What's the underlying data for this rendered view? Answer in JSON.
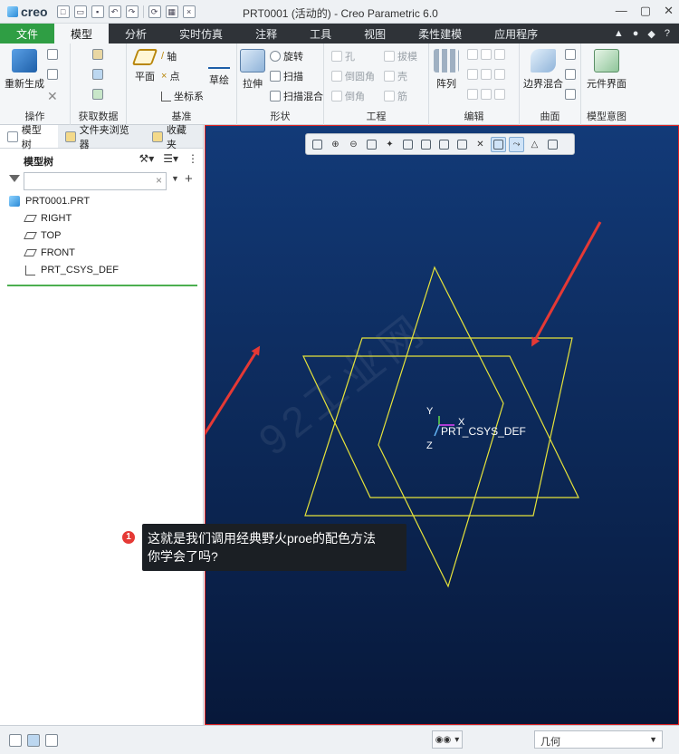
{
  "app": {
    "brand": "creo",
    "window_title": "PRT0001 (活动的) - Creo Parametric 6.0"
  },
  "ribbon_tabs": [
    "文件",
    "模型",
    "分析",
    "实时仿真",
    "注释",
    "工具",
    "视图",
    "柔性建模",
    "应用程序"
  ],
  "ribbon": {
    "operations": {
      "regenerate": "重新生成",
      "label": "操作"
    },
    "get_data": {
      "label": "获取数据"
    },
    "datum": {
      "plane": "平面",
      "axis": "轴",
      "point": "点",
      "csys": "坐标系",
      "sketch": "草绘",
      "label": "基准"
    },
    "shapes": {
      "extrude": "拉伸",
      "revolve": "旋转",
      "sweep": "扫描",
      "swept_blend": "扫描混合",
      "label": "形状"
    },
    "engineering": {
      "hole": "孔",
      "draft": "拔模",
      "round": "倒圆角",
      "shell": "壳",
      "chamfer": "倒角",
      "rib": "筋",
      "label": "工程"
    },
    "editing": {
      "pattern": "阵列",
      "label": "编辑"
    },
    "surfaces": {
      "boundary_blend": "边界混合",
      "label": "曲面"
    },
    "model_intent": {
      "component_interface": "元件界面",
      "label": "模型意图"
    }
  },
  "panel": {
    "tabs": [
      "模型树",
      "文件夹浏览器",
      "收藏夹"
    ],
    "tree_label": "模型树",
    "search_value": "",
    "tree": [
      {
        "label": "PRT0001.PRT",
        "icon": "part-icon"
      },
      {
        "label": "RIGHT",
        "icon": "datum-plane-icon"
      },
      {
        "label": "TOP",
        "icon": "datum-plane-icon"
      },
      {
        "label": "FRONT",
        "icon": "datum-plane-icon"
      },
      {
        "label": "PRT_CSYS_DEF",
        "icon": "csys-icon"
      }
    ]
  },
  "viewport": {
    "axis_labels": {
      "x": "X",
      "y": "Y",
      "z": "Z"
    },
    "csys_label": "PRT_CSYS_DEF",
    "watermark": "92工业网",
    "plane_color": "#e6e33a",
    "background_top": "#123a78",
    "background_bottom": "#07183a",
    "arrow_color": "#e53935"
  },
  "callout": {
    "badge": "1",
    "line1": "这就是我们调用经典野火proe的配色方法",
    "line2": "你学会了吗?"
  },
  "status": {
    "filter_value": "几何"
  }
}
